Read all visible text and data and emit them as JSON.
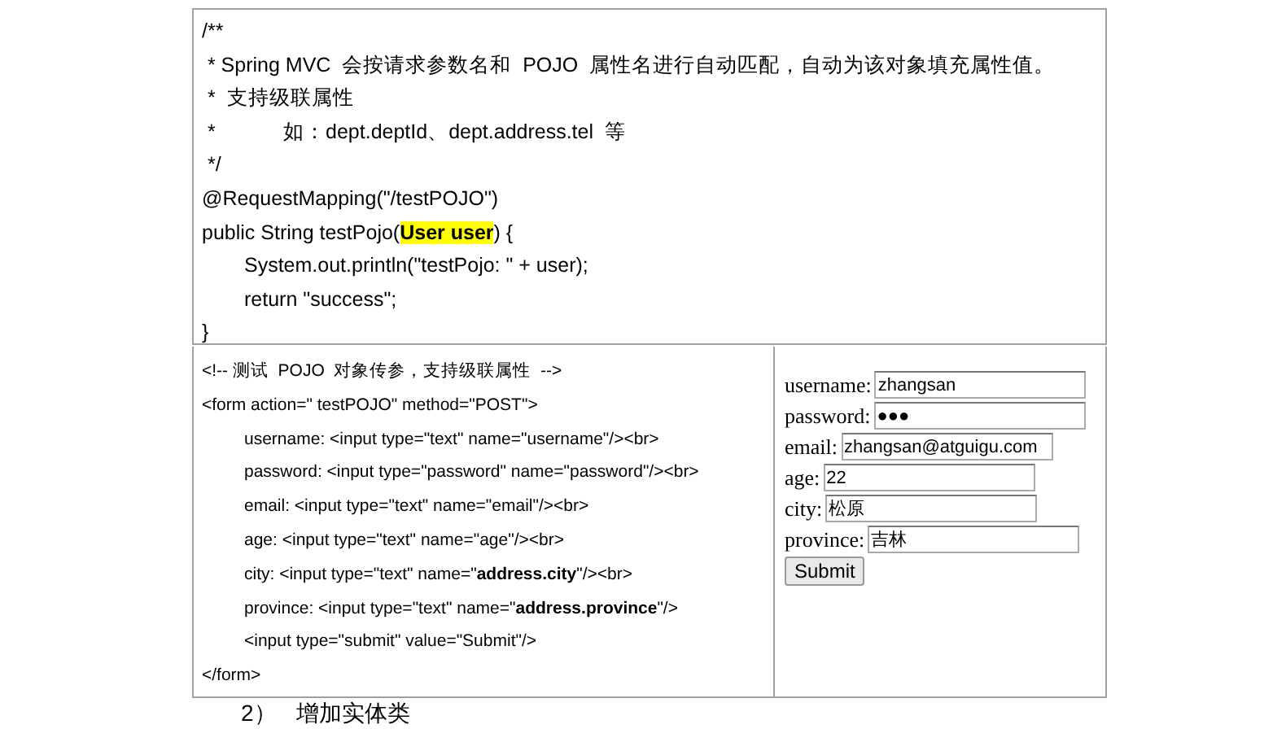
{
  "java_code": {
    "lines": [
      {
        "kind": "plain",
        "text": "/**"
      },
      {
        "kind": "plain",
        "text": " * Spring MVC  会按请求参数名和  POJO  属性名进行自动匹配，自动为该对象填充属性值。"
      },
      {
        "kind": "plain",
        "text": " *  支持级联属性"
      },
      {
        "kind": "plain",
        "text": " *            如：dept.deptId、dept.address.tel  等"
      },
      {
        "kind": "plain",
        "text": " */"
      },
      {
        "kind": "plain",
        "text": "@RequestMapping(\"/testPOJO\")"
      },
      {
        "kind": "plain",
        "text": "public String testPojo(**User user**) {"
      },
      {
        "kind": "body",
        "text": "System.out.println(\"testPojo: \" + user);"
      },
      {
        "kind": "body",
        "text": "return \"success\";"
      },
      {
        "kind": "plain",
        "text": "}"
      }
    ]
  },
  "html_code": {
    "lines": [
      {
        "kind": "plain",
        "text": "<!-- 测试  POJO  对象传参，支持级联属性  -->"
      },
      {
        "kind": "plain",
        "text": "<form action=\" testPOJO\" method=\"POST\">"
      },
      {
        "kind": "body",
        "text": "username: <input type=\"text\" name=\"username\"/><br>"
      },
      {
        "kind": "body",
        "text": "password: <input type=\"password\" name=\"password\"/><br>"
      },
      {
        "kind": "body",
        "text": "email: <input type=\"text\" name=\"email\"/><br>"
      },
      {
        "kind": "body",
        "text": "age: <input type=\"text\" name=\"age\"/><br>"
      },
      {
        "kind": "body",
        "text": "city: <input type=\"text\" name=\"**address.city**\"/><br>"
      },
      {
        "kind": "body",
        "text": "province: <input type=\"text\" name=\"**address.province**\"/>"
      },
      {
        "kind": "body",
        "text": "<input type=\"submit\" value=\"Submit\"/>"
      },
      {
        "kind": "plain",
        "text": "</form>"
      }
    ]
  },
  "form_preview": {
    "fields": [
      {
        "label": "username:",
        "value": "zhangsan"
      },
      {
        "label": "password:",
        "value": "●●●"
      },
      {
        "label": "email:",
        "value": "zhangsan@atguigu.com"
      },
      {
        "label": "age:",
        "value": "22"
      },
      {
        "label": "city:",
        "value": "松原"
      },
      {
        "label": "province:",
        "value": "吉林"
      }
    ],
    "submit": "Submit"
  },
  "footer": {
    "number": "2）",
    "heading": "增加实体类"
  }
}
